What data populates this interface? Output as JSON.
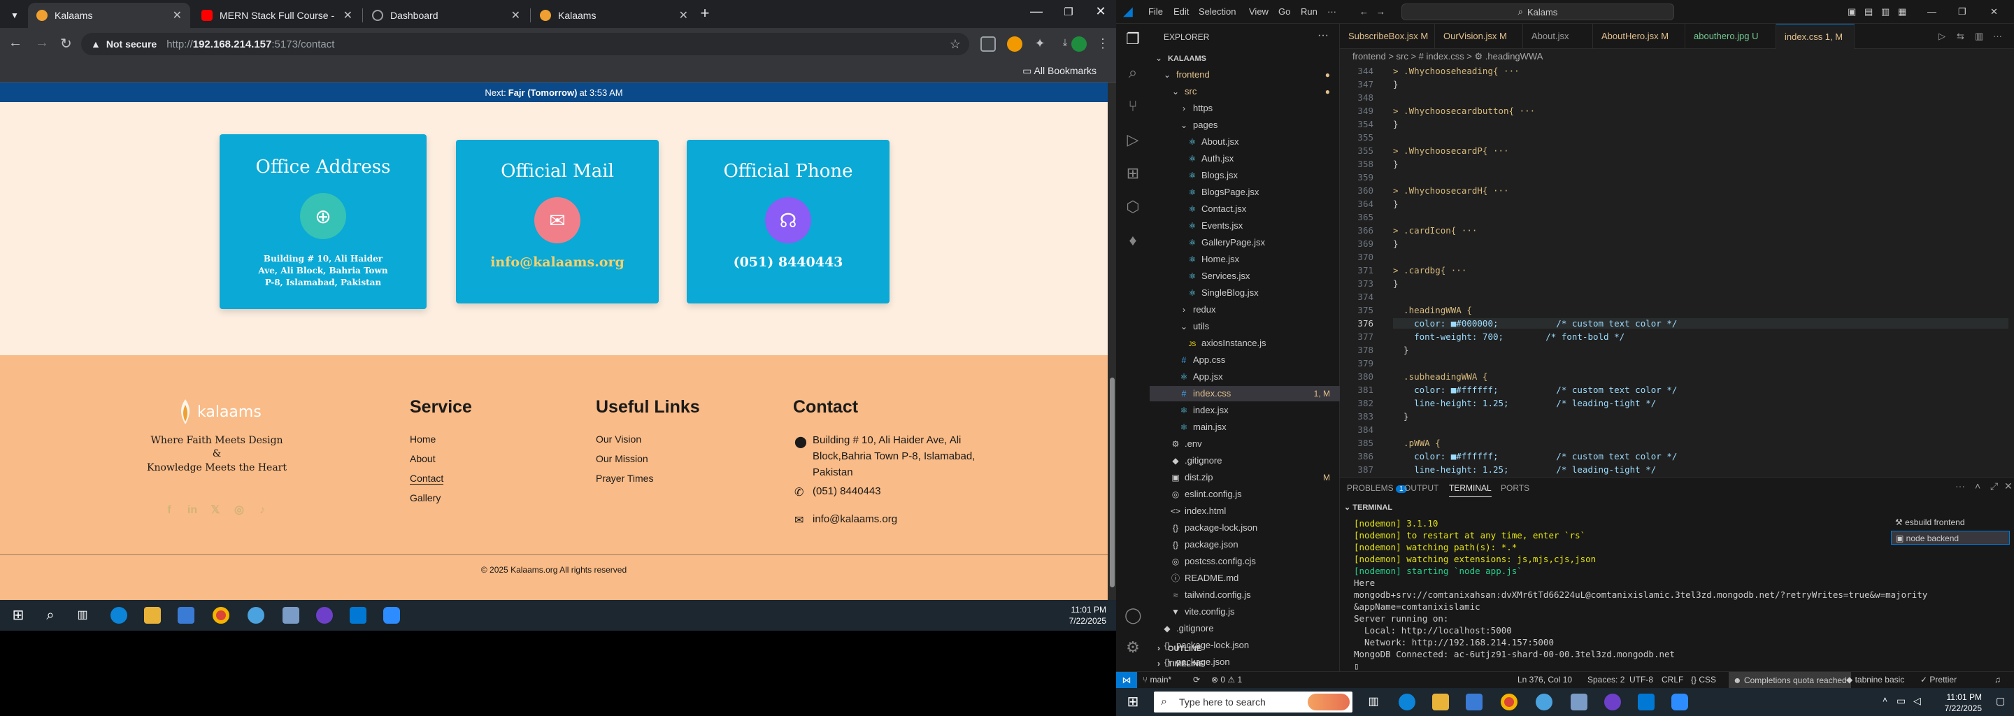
{
  "chrome": {
    "tabs": [
      {
        "title": "Kalaams",
        "color": "#f0a030"
      },
      {
        "title": "MERN Stack Full Course - ECom",
        "color": "#ff0000"
      },
      {
        "title": "Dashboard",
        "color": "#5f6368"
      },
      {
        "title": "Kalaams",
        "color": "#f0a030"
      }
    ],
    "not_secure": "Not secure",
    "url_prefix": "http://",
    "url_host": "192.168.214.157",
    "url_path": ":5173/contact",
    "all_bookmarks": "All Bookmarks"
  },
  "site": {
    "prayer_prefix": "Next:",
    "prayer_name": "Fajr (Tomorrow)",
    "prayer_time": "at 3:53 AM",
    "cards": {
      "address_title": "Office Address",
      "address_value": "Building # 10, Ali Haider Ave, Ali Block, Bahria Town P-8, Islamabad, Pakistan",
      "mail_title": "Official Mail",
      "mail_value": "info@kalaams.org",
      "phone_title": "Official Phone",
      "phone_value": "(051) 8440443"
    },
    "footer": {
      "logo_text": "kalaams",
      "tagline1": "Where Faith Meets Design",
      "tagline2": "&",
      "tagline3": "Knowledge Meets the Heart",
      "service_heading": "Service",
      "service_links": [
        "Home",
        "About",
        "Contact",
        "Gallery"
      ],
      "useful_heading": "Useful Links",
      "useful_links": [
        "Our Vision",
        "Our Mission",
        "Prayer Times"
      ],
      "contact_heading": "Contact",
      "contact_address": "Building # 10, Ali Haider Ave, Ali Block,Bahria Town P-8, Islamabad, Pakistan",
      "contact_phone": "(051) 8440443",
      "contact_email": "info@kalaams.org",
      "copyright": "© 2025 Kalaams.org All rights reserved"
    }
  },
  "taskbar_left": {
    "time": "11:01 PM",
    "date": "7/22/2025"
  },
  "vscode": {
    "menu": [
      "File",
      "Edit",
      "Selection",
      "View",
      "Go",
      "Run",
      "···"
    ],
    "search": "Kalams",
    "explorer_title": "EXPLORER",
    "tree": [
      {
        "label": "KALAAMS",
        "indent": 0,
        "icon": "v"
      },
      {
        "label": "frontend",
        "indent": 1,
        "icon": "v",
        "color": "#e2c08d"
      },
      {
        "label": "src",
        "indent": 2,
        "icon": "v",
        "color": "#e2c08d"
      },
      {
        "label": "https",
        "indent": 3,
        "icon": ">"
      },
      {
        "label": "pages",
        "indent": 3,
        "icon": "v"
      },
      {
        "label": "About.jsx",
        "indent": 4,
        "icon": "⚛"
      },
      {
        "label": "Auth.jsx",
        "indent": 4,
        "icon": "⚛"
      },
      {
        "label": "Blogs.jsx",
        "indent": 4,
        "icon": "⚛"
      },
      {
        "label": "BlogsPage.jsx",
        "indent": 4,
        "icon": "⚛"
      },
      {
        "label": "Contact.jsx",
        "indent": 4,
        "icon": "⚛"
      },
      {
        "label": "Events.jsx",
        "indent": 4,
        "icon": "⚛"
      },
      {
        "label": "GalleryPage.jsx",
        "indent": 4,
        "icon": "⚛"
      },
      {
        "label": "Home.jsx",
        "indent": 4,
        "icon": "⚛"
      },
      {
        "label": "Services.jsx",
        "indent": 4,
        "icon": "⚛"
      },
      {
        "label": "SingleBlog.jsx",
        "indent": 4,
        "icon": "⚛"
      },
      {
        "label": "redux",
        "indent": 3,
        "icon": ">"
      },
      {
        "label": "utils",
        "indent": 3,
        "icon": "v"
      },
      {
        "label": "axiosInstance.js",
        "indent": 4,
        "icon": "JS"
      },
      {
        "label": "App.css",
        "indent": 3,
        "icon": "#"
      },
      {
        "label": "App.jsx",
        "indent": 3,
        "icon": "⚛"
      },
      {
        "label": "index.css",
        "indent": 3,
        "icon": "#",
        "color": "#e2c08d",
        "badge": "1, M",
        "selected": true
      },
      {
        "label": "index.jsx",
        "indent": 3,
        "icon": "⚛"
      },
      {
        "label": "main.jsx",
        "indent": 3,
        "icon": "⚛"
      },
      {
        "label": ".env",
        "indent": 2,
        "icon": "⚙"
      },
      {
        "label": ".gitignore",
        "indent": 2,
        "icon": "◆"
      },
      {
        "label": "dist.zip",
        "indent": 2,
        "icon": "▣",
        "badge": "M"
      },
      {
        "label": "eslint.config.js",
        "indent": 2,
        "icon": "◎"
      },
      {
        "label": "index.html",
        "indent": 2,
        "icon": "<>"
      },
      {
        "label": "package-lock.json",
        "indent": 2,
        "icon": "{}"
      },
      {
        "label": "package.json",
        "indent": 2,
        "icon": "{}"
      },
      {
        "label": "postcss.config.cjs",
        "indent": 2,
        "icon": "◎"
      },
      {
        "label": "README.md",
        "indent": 2,
        "icon": "ⓘ"
      },
      {
        "label": "tailwind.config.js",
        "indent": 2,
        "icon": "≈"
      },
      {
        "label": "vite.config.js",
        "indent": 2,
        "icon": "▼"
      },
      {
        "label": ".gitignore",
        "indent": 1,
        "icon": "◆"
      },
      {
        "label": "package-lock.json",
        "indent": 1,
        "icon": "{}"
      },
      {
        "label": "package.json",
        "indent": 1,
        "icon": "{}"
      },
      {
        "label": "README.md",
        "indent": 1,
        "icon": "ⓘ"
      }
    ],
    "outline": "OUTLINE",
    "timeline": "TIMELINE",
    "tabs": [
      {
        "label": "SubscribeBox.jsx M",
        "color": "#e2c08d"
      },
      {
        "label": "OurVision.jsx M",
        "color": "#e2c08d"
      },
      {
        "label": "About.jsx",
        "color": "#9d9d9d"
      },
      {
        "label": "AboutHero.jsx M",
        "color": "#e2c08d"
      },
      {
        "label": "abouthero.jpg U",
        "color": "#73c991"
      },
      {
        "label": "index.css 1, M",
        "color": "#e2c08d",
        "active": true
      }
    ],
    "breadcrumb": "frontend  >  src  >  # index.css  >  ⚙ .headingWWA",
    "code_lines": [
      {
        "n": "344",
        "t": "> .Whychooseheading{ ··· "
      },
      {
        "n": "347",
        "t": "}"
      },
      {
        "n": "348",
        "t": ""
      },
      {
        "n": "349",
        "t": "> .Whychoosecardbutton{ ··· "
      },
      {
        "n": "354",
        "t": "}"
      },
      {
        "n": "355",
        "t": ""
      },
      {
        "n": "355",
        "t": "> .WhychoosecardP{ ··· "
      },
      {
        "n": "358",
        "t": "}"
      },
      {
        "n": "359",
        "t": ""
      },
      {
        "n": "360",
        "t": "> .WhychoosecardH{ ··· "
      },
      {
        "n": "364",
        "t": "}"
      },
      {
        "n": "365",
        "t": ""
      },
      {
        "n": "366",
        "t": "> .cardIcon{ ··· "
      },
      {
        "n": "369",
        "t": "}"
      },
      {
        "n": "370",
        "t": ""
      },
      {
        "n": "371",
        "t": "> .cardbg{ ··· "
      },
      {
        "n": "373",
        "t": "}"
      },
      {
        "n": "374",
        "t": ""
      },
      {
        "n": "375",
        "t": "  .headingWWA {"
      },
      {
        "n": "376",
        "t": "    color: ■#000000;           /* custom text color */"
      },
      {
        "n": "377",
        "t": "    font-weight: 700;        /* font-bold */"
      },
      {
        "n": "378",
        "t": "  }"
      },
      {
        "n": "379",
        "t": ""
      },
      {
        "n": "380",
        "t": "  .subheadingWWA {"
      },
      {
        "n": "381",
        "t": "    color: ■#ffffff;           /* custom text color */"
      },
      {
        "n": "382",
        "t": "    line-height: 1.25;         /* leading-tight */"
      },
      {
        "n": "383",
        "t": "  }"
      },
      {
        "n": "384",
        "t": ""
      },
      {
        "n": "385",
        "t": "  .pWWA {"
      },
      {
        "n": "386",
        "t": "    color: ■#ffffff;           /* custom text color */"
      },
      {
        "n": "387",
        "t": "    line-height: 1.25;         /* leading-tight */"
      }
    ],
    "panel_tabs": [
      "PROBLEMS",
      "OUTPUT",
      "TERMINAL",
      "PORTS"
    ],
    "problems_count": "1",
    "terminal_header": "TERMINAL",
    "terminal_lines": [
      {
        "t": "[nodemon] 3.1.10",
        "c": "y"
      },
      {
        "t": "[nodemon] to restart at any time, enter `rs`",
        "c": "y"
      },
      {
        "t": "[nodemon] watching path(s): *.*",
        "c": "y"
      },
      {
        "t": "[nodemon] watching extensions: js,mjs,cjs,json",
        "c": "y"
      },
      {
        "t": "[nodemon] starting `node app.js`",
        "c": "g"
      },
      {
        "t": "Here",
        "c": ""
      },
      {
        "t": "mongodb+srv://comtanixahsan:dvXMr6tTd66224uL@comtanixislamic.3tel3zd.mongodb.net/?retryWrites=true&w=majority",
        "c": ""
      },
      {
        "t": "&appName=comtanixislamic",
        "c": ""
      },
      {
        "t": "Server running on:",
        "c": ""
      },
      {
        "t": "  Local: http://localhost:5000",
        "c": ""
      },
      {
        "t": "  Network: http://192.168.214.157:5000",
        "c": ""
      },
      {
        "t": "MongoDB Connected: ac-6utjz91-shard-00-00.3tel3zd.mongodb.net",
        "c": ""
      },
      {
        "t": "▯",
        "c": ""
      }
    ],
    "terminal_instances": [
      "esbuild  frontend",
      "node  backend"
    ],
    "status": {
      "branch": "main*",
      "errors": "⊗ 0 ⚠ 1",
      "position": "Ln 376, Col 10",
      "spaces": "Spaces: 2",
      "encoding": "UTF-8",
      "eol": "CRLF",
      "lang": "CSS",
      "completions": "Completions quota reached",
      "tabnine": "tabnine basic",
      "prettier": "Prettier"
    }
  },
  "taskbar_right": {
    "search_placeholder": "Type here to search",
    "time": "11:01 PM",
    "date": "7/22/2025"
  }
}
